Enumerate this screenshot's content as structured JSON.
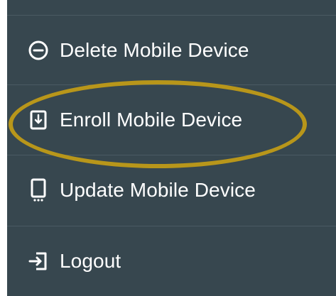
{
  "menu": {
    "items": [
      {
        "label": "Delete Mobile Device",
        "icon": "minus-circle-icon"
      },
      {
        "label": "Enroll Mobile Device",
        "icon": "device-download-icon"
      },
      {
        "label": "Update Mobile Device",
        "icon": "mobile-phone-icon"
      },
      {
        "label": "Logout",
        "icon": "logout-icon"
      }
    ]
  },
  "colors": {
    "menu_background": "#37474f",
    "divider": "#4a5a63",
    "text": "#ffffff",
    "highlight": "#b8961a"
  }
}
